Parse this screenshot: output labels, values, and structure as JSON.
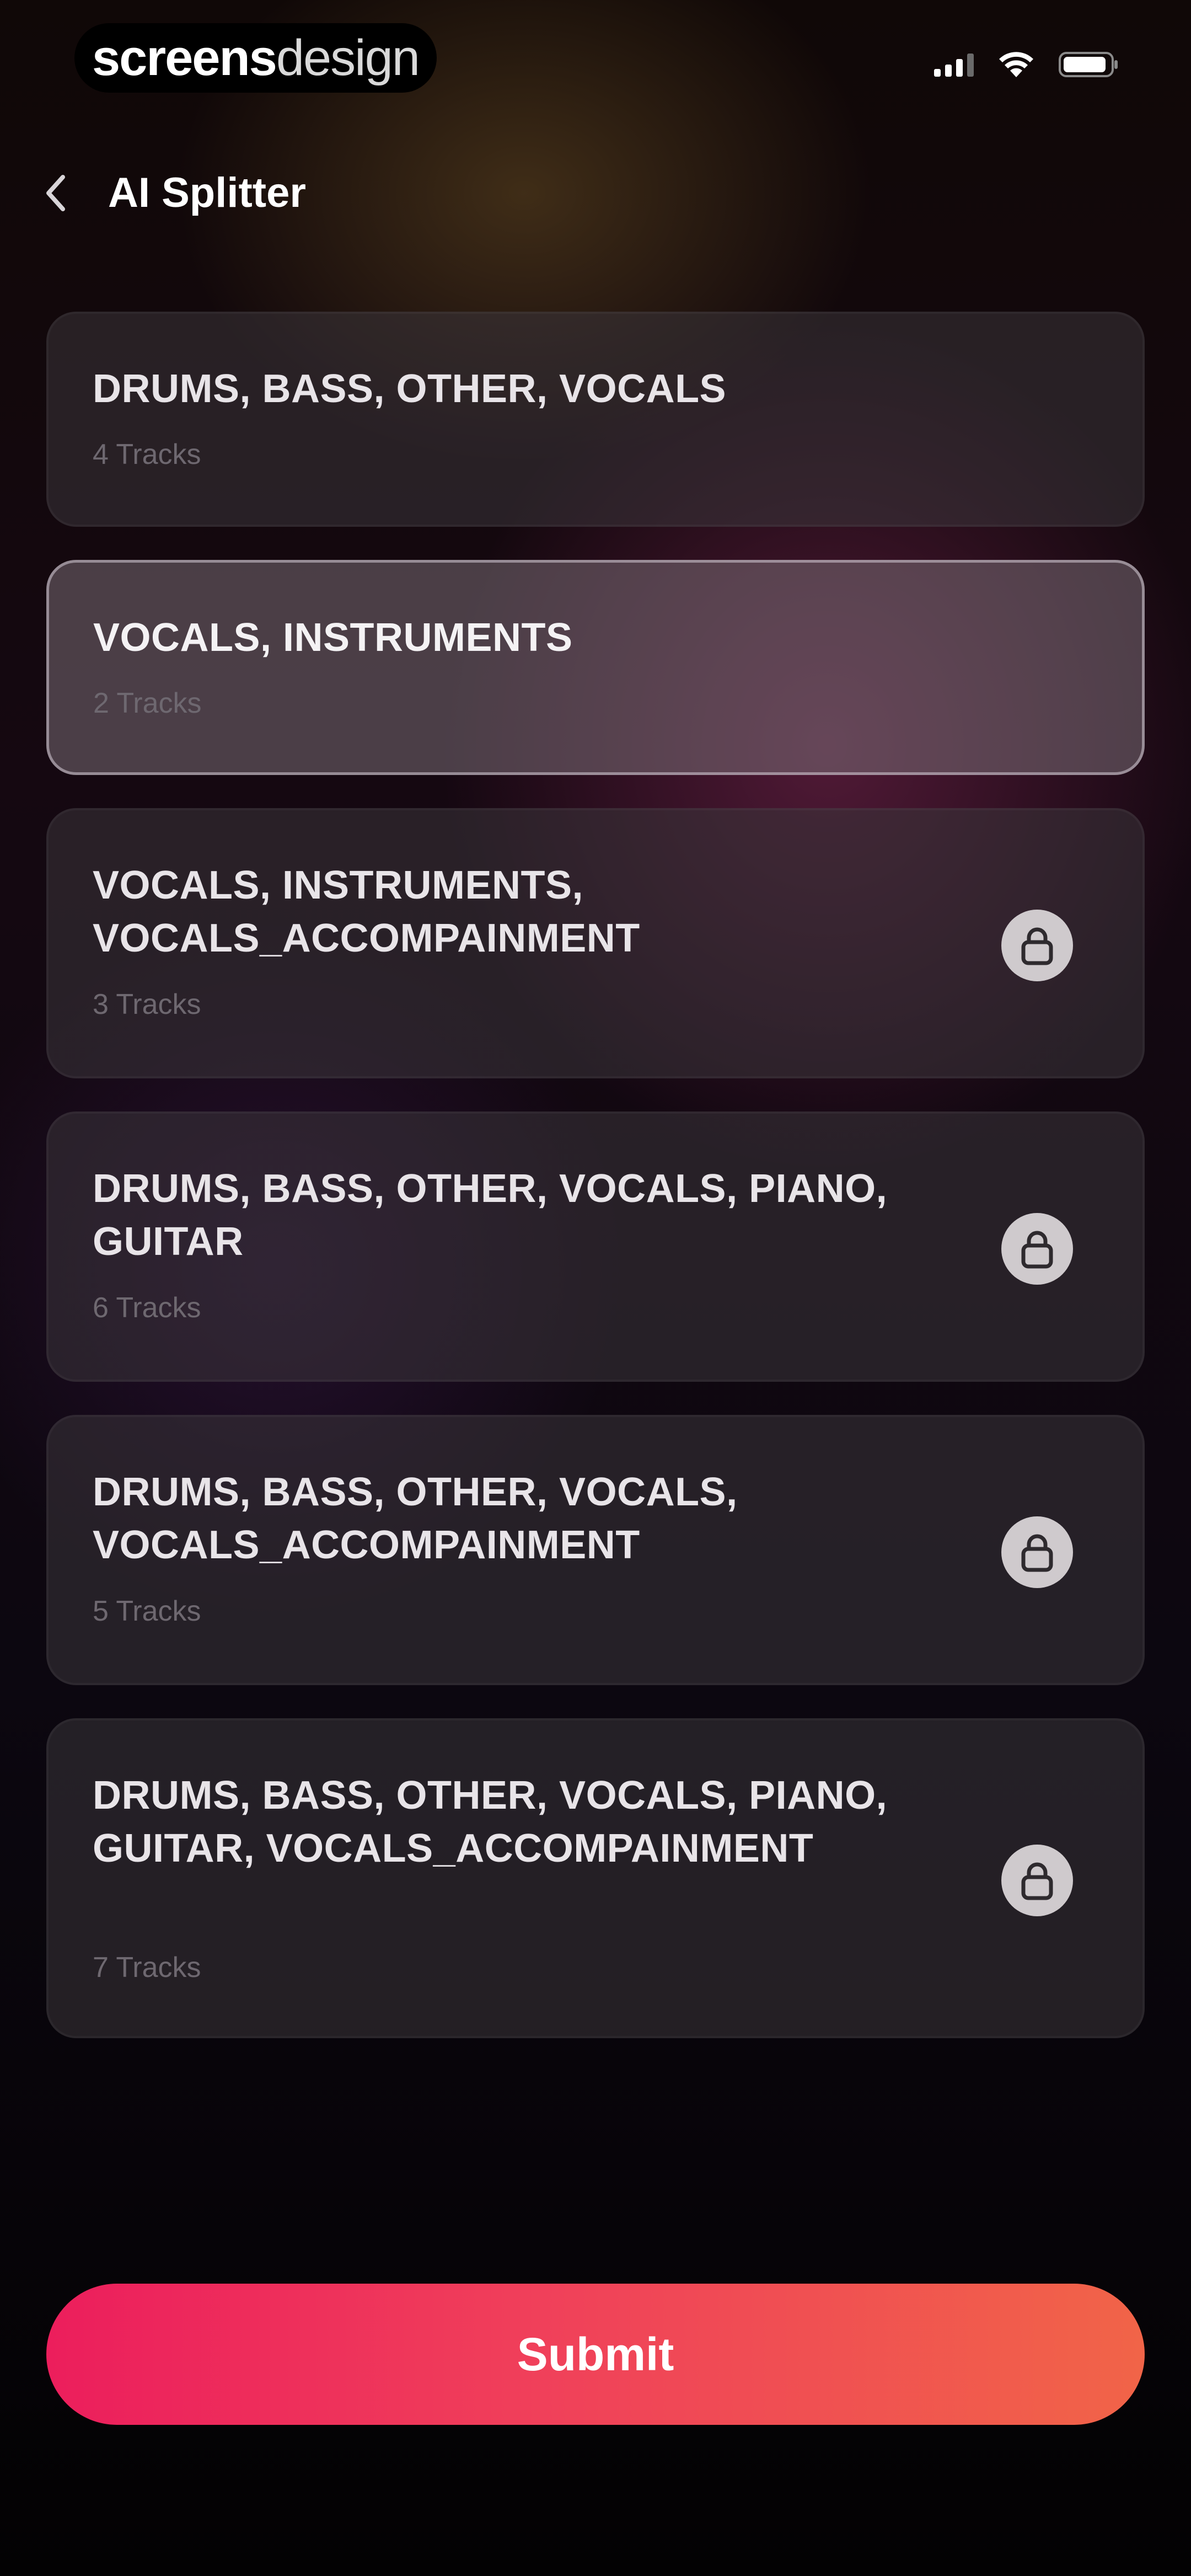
{
  "status_bar": {
    "brand_part1": "screens",
    "brand_part2": "design"
  },
  "nav": {
    "title": "AI Splitter"
  },
  "options": [
    {
      "title": "DRUMS, BASS, OTHER, VOCALS",
      "subtitle": "4 Tracks",
      "selected": false,
      "locked": false
    },
    {
      "title": "VOCALS, INSTRUMENTS",
      "subtitle": "2 Tracks",
      "selected": true,
      "locked": false
    },
    {
      "title": "VOCALS, INSTRUMENTS, VOCALS_ACCOMPAINMENT",
      "subtitle": "3 Tracks",
      "selected": false,
      "locked": true
    },
    {
      "title": "DRUMS, BASS, OTHER, VOCALS, PIANO, GUITAR",
      "subtitle": "6 Tracks",
      "selected": false,
      "locked": true
    },
    {
      "title": "DRUMS, BASS, OTHER, VOCALS, VOCALS_ACCOMPAINMENT",
      "subtitle": "5 Tracks",
      "selected": false,
      "locked": true
    },
    {
      "title": "DRUMS, BASS, OTHER, VOCALS, PIANO, GUITAR, VOCALS_ACCOMPAINMENT",
      "subtitle": "7 Tracks",
      "selected": false,
      "locked": true
    }
  ],
  "submit_label": "Submit",
  "icons": {
    "signal": "signal-icon",
    "wifi": "wifi-icon",
    "battery": "battery-icon",
    "back": "chevron-left-icon",
    "lock": "lock-icon"
  },
  "colors": {
    "accent_start": "#ec1e5c",
    "accent_end": "#f16448"
  }
}
